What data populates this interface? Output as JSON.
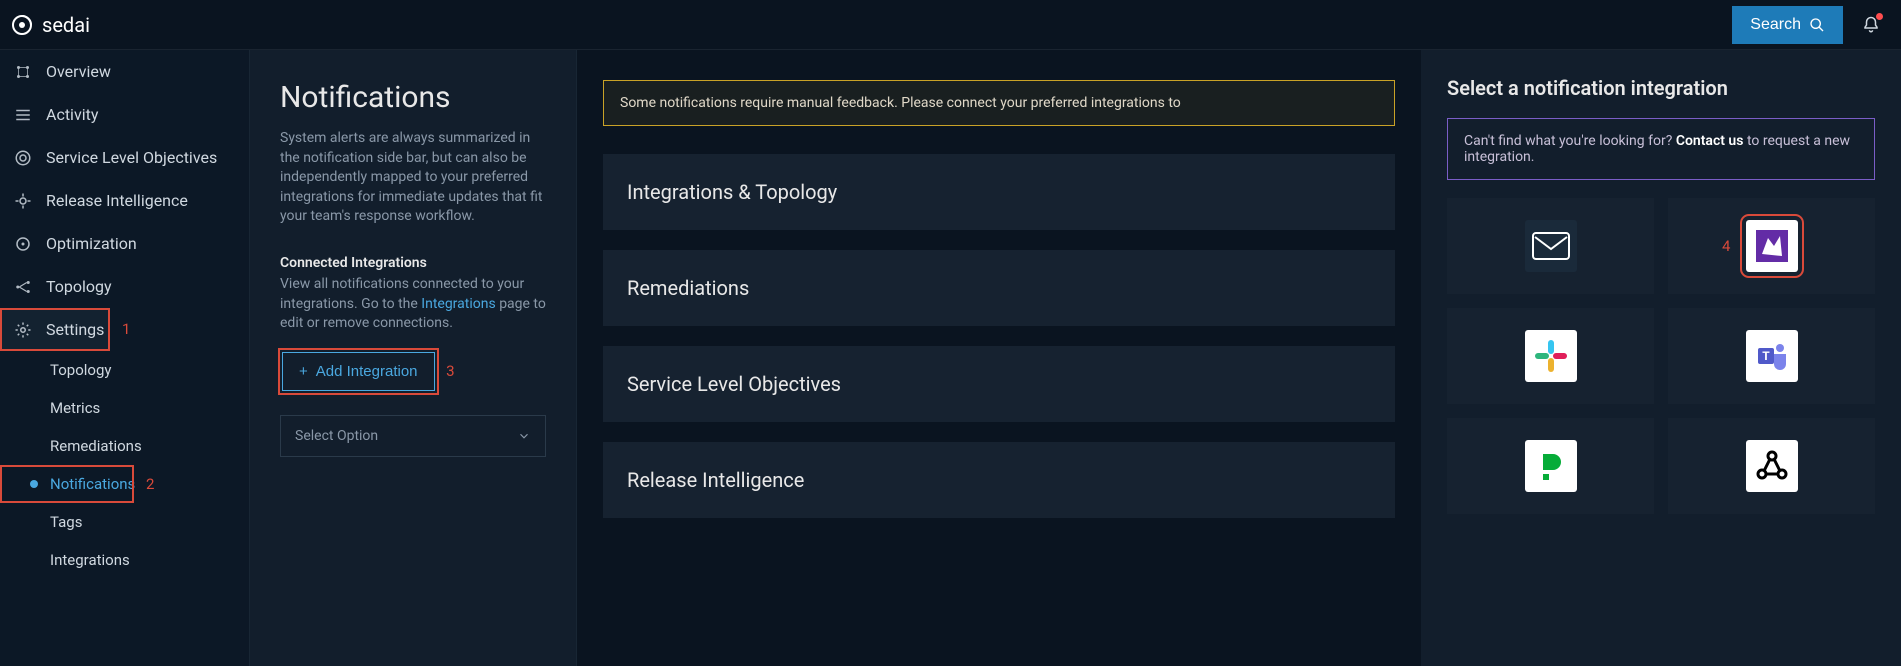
{
  "brand": {
    "name": "sedai"
  },
  "topbar": {
    "search_label": "Search"
  },
  "sidebar": {
    "items": [
      {
        "label": "Overview",
        "icon": "overview"
      },
      {
        "label": "Activity",
        "icon": "activity"
      },
      {
        "label": "Service Level Objectives",
        "icon": "slo"
      },
      {
        "label": "Release Intelligence",
        "icon": "release"
      },
      {
        "label": "Optimization",
        "icon": "optimize"
      },
      {
        "label": "Topology",
        "icon": "topology"
      },
      {
        "label": "Settings",
        "icon": "settings",
        "step": "1"
      }
    ],
    "sub_items": [
      {
        "label": "Topology"
      },
      {
        "label": "Metrics"
      },
      {
        "label": "Remediations"
      },
      {
        "label": "Notifications",
        "active": true,
        "step": "2"
      },
      {
        "label": "Tags"
      },
      {
        "label": "Integrations"
      }
    ]
  },
  "left": {
    "title": "Notifications",
    "description": "System alerts are always summarized in the notification side bar, but can also be independently mapped to your preferred integrations for immediate updates that fit your team's response workflow.",
    "connected_title": "Connected Integrations",
    "connected_desc1": "View all notifications connected to your integrations. Go to the",
    "connected_link": "Integrations",
    "connected_desc2": "page to edit or remove connections.",
    "add_label": "Add Integration",
    "add_step": "3",
    "select_placeholder": "Select Option"
  },
  "mid": {
    "warning_text": "Some notifications require manual feedback. Please connect your preferred integrations to",
    "categories": [
      "Integrations & Topology",
      "Remediations",
      "Service Level Objectives",
      "Release Intelligence"
    ]
  },
  "right": {
    "title": "Select a notification integration",
    "contact_pre": "Can't find what you're looking for?",
    "contact_link": "Contact us",
    "contact_post": "to request a new integration.",
    "tiles": [
      {
        "id": "email",
        "label": "Email"
      },
      {
        "id": "datadog",
        "label": "Datadog",
        "step": "4"
      },
      {
        "id": "slack",
        "label": "Slack"
      },
      {
        "id": "teams",
        "label": "Microsoft Teams"
      },
      {
        "id": "pagerduty",
        "label": "PagerDuty"
      },
      {
        "id": "webhook",
        "label": "Webhook"
      }
    ]
  }
}
